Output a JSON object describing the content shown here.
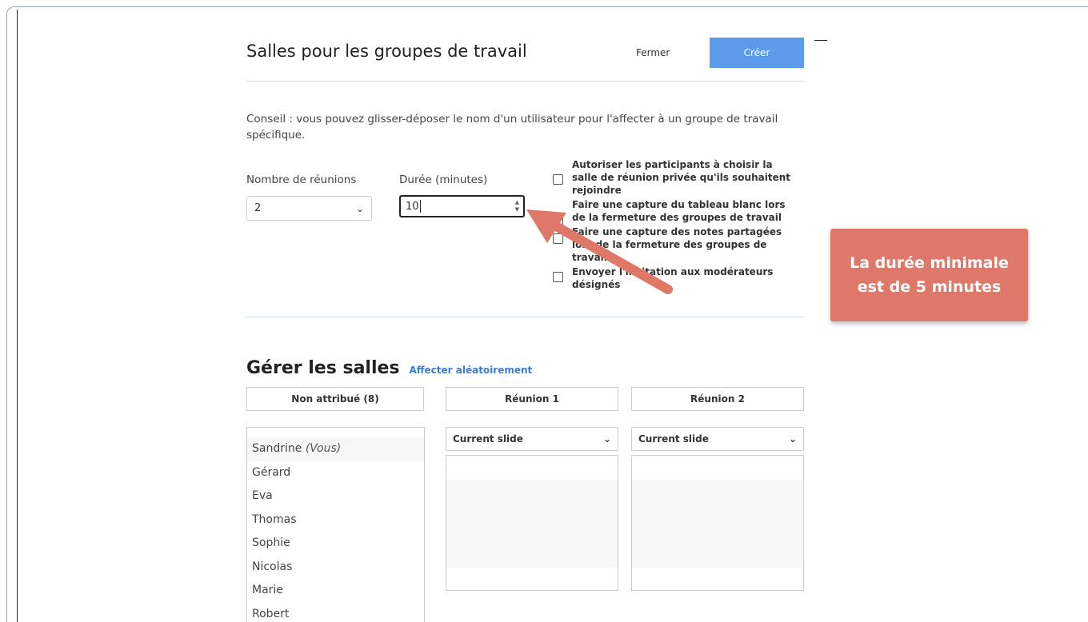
{
  "dialog": {
    "title": "Salles pour les groupes de travail",
    "close_label": "Fermer",
    "create_label": "Créer",
    "hint": "Conseil : vous pouvez glisser-déposer le nom d'un utilisateur pour l'affecter à un groupe de travail spécifique."
  },
  "settings": {
    "count_label": "Nombre de réunions",
    "count_value": "2",
    "duration_label": "Durée (minutes)",
    "duration_value": "10"
  },
  "options": [
    {
      "label": "Autoriser les participants à choisir la salle de réunion privée qu'ils souhaitent rejoindre",
      "checked": false
    },
    {
      "label": "Faire une capture du tableau blanc lors de la fermeture des groupes de travail",
      "checked": false
    },
    {
      "label": "Faire une capture des notes partagées lors de la fermeture des groupes de travail",
      "checked": false
    },
    {
      "label": "Envoyer l'invitation aux modérateurs désignés",
      "checked": false
    }
  ],
  "callout": {
    "line1": "La durée minimale",
    "line2": "est de 5 minutes",
    "color": "#e0786a"
  },
  "manage": {
    "title": "Gérer les salles",
    "random_link": "Affecter aléatoirement",
    "unassigned_header": "Non attribué (8)",
    "room1_header": "Réunion 1",
    "room2_header": "Réunion 2",
    "room1_select": "Current slide",
    "room2_select": "Current slide",
    "members": [
      {
        "name": "Sandrine",
        "suffix": "(Vous)"
      },
      {
        "name": "Gérard",
        "suffix": ""
      },
      {
        "name": "Eva",
        "suffix": ""
      },
      {
        "name": "Thomas",
        "suffix": ""
      },
      {
        "name": "Sophie",
        "suffix": ""
      },
      {
        "name": "Nicolas",
        "suffix": ""
      },
      {
        "name": "Marie",
        "suffix": ""
      },
      {
        "name": "Robert",
        "suffix": ""
      }
    ]
  },
  "colors": {
    "primary_button": "#5b9bea",
    "link": "#3a7bd5",
    "arrow": "#e0786a"
  }
}
